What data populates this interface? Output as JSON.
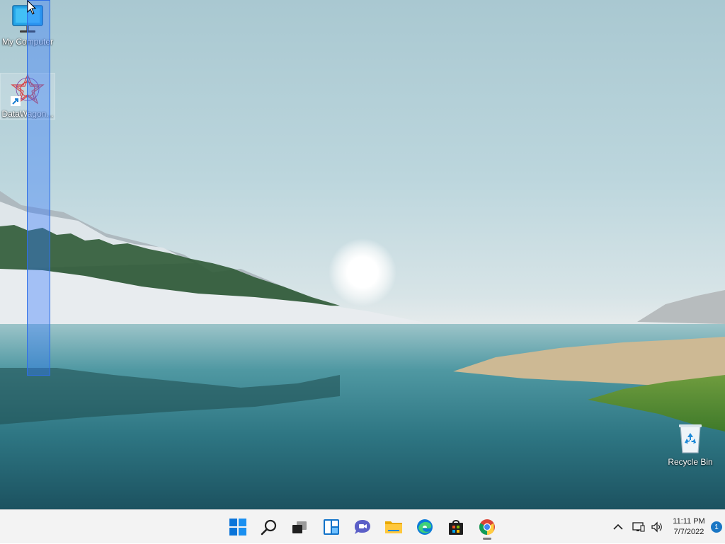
{
  "desktop": {
    "icons": [
      {
        "label": "My Computer",
        "icon": "monitor-icon"
      },
      {
        "label": "DataWagon...",
        "icon": "datawagon-icon"
      },
      {
        "label": "Recycle Bin",
        "icon": "recycle-bin-icon"
      }
    ]
  },
  "taskbar": {
    "apps": [
      {
        "name": "Start",
        "icon": "windows-start-icon"
      },
      {
        "name": "Search",
        "icon": "search-icon"
      },
      {
        "name": "Task View",
        "icon": "task-view-icon"
      },
      {
        "name": "Widgets",
        "icon": "widgets-icon"
      },
      {
        "name": "Chat",
        "icon": "chat-icon"
      },
      {
        "name": "File Explorer",
        "icon": "folder-icon"
      },
      {
        "name": "Microsoft Edge",
        "icon": "edge-icon"
      },
      {
        "name": "Microsoft Store",
        "icon": "store-icon"
      },
      {
        "name": "Google Chrome",
        "icon": "chrome-icon",
        "running": true
      }
    ],
    "tray": {
      "time": "11:11 PM",
      "date": "7/7/2022",
      "notification_count": "1"
    }
  },
  "colors": {
    "selection_fill": "#3378ff",
    "taskbar_bg": "#f3f3f3",
    "accent": "#1976c4"
  }
}
